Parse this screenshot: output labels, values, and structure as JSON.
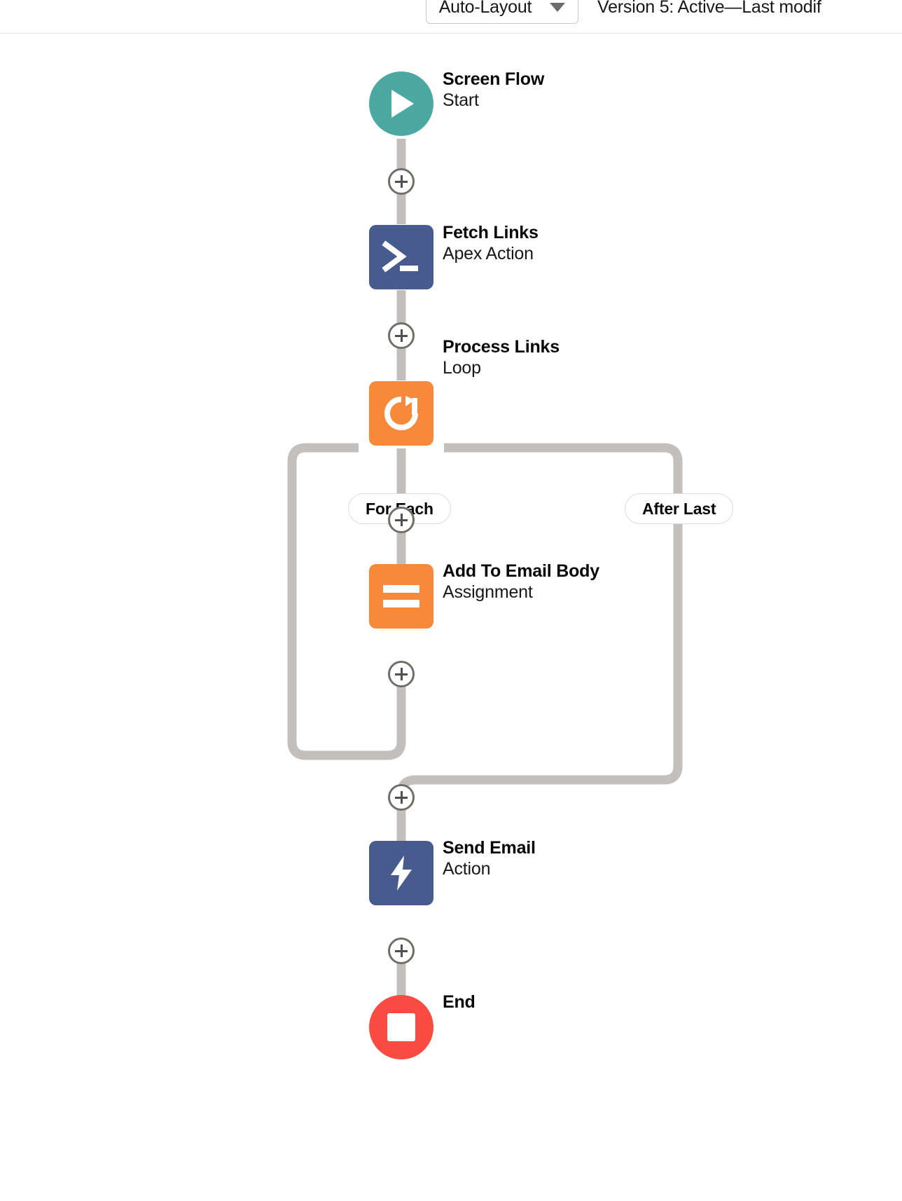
{
  "header": {
    "layout_mode": "Auto-Layout",
    "layout_caret_icon": "chevron-down-icon",
    "version_status": "Version 5: Active—Last modif"
  },
  "colors": {
    "start_teal": "#4BA8A3",
    "action_navy": "#485B8E",
    "loop_orange": "#F8893B",
    "assignment_orange": "#F8893B",
    "end_red": "#FA4B42",
    "connector_gray": "#C2BFBC",
    "plus_border": "#706E6B"
  },
  "canvas": {
    "nodes": [
      {
        "id": "start",
        "title": "Screen Flow",
        "subtitle": "Start",
        "icon": "play-icon",
        "shape": "circle",
        "color": "#4BA8A3"
      },
      {
        "id": "fetch-links",
        "title": "Fetch Links",
        "subtitle": "Apex Action",
        "icon": "terminal-prompt-icon",
        "shape": "square",
        "color": "#485B8E"
      },
      {
        "id": "process-links",
        "title": "Process Links",
        "subtitle": "Loop",
        "icon": "loop-refresh-icon",
        "shape": "square",
        "color": "#F8893B"
      },
      {
        "id": "add-to-email-body",
        "title": "Add To Email Body",
        "subtitle": "Assignment",
        "icon": "equals-assignment-icon",
        "shape": "square",
        "color": "#F8893B"
      },
      {
        "id": "send-email",
        "title": "Send Email",
        "subtitle": "Action",
        "icon": "lightning-bolt-icon",
        "shape": "square",
        "color": "#485B8E"
      },
      {
        "id": "end",
        "title": "End",
        "subtitle": "",
        "icon": "stop-square-icon",
        "shape": "circle",
        "color": "#FA4B42"
      }
    ],
    "branch_labels": [
      {
        "id": "for-each",
        "label": "For Each"
      },
      {
        "id": "after-last",
        "label": "After Last"
      }
    ],
    "add_buttons": [
      {
        "id": "add-after-start"
      },
      {
        "id": "add-after-fetch-links"
      },
      {
        "id": "add-in-loop-before-assignment"
      },
      {
        "id": "add-in-loop-after-assignment"
      },
      {
        "id": "add-after-loop"
      },
      {
        "id": "add-after-send-email"
      }
    ]
  }
}
